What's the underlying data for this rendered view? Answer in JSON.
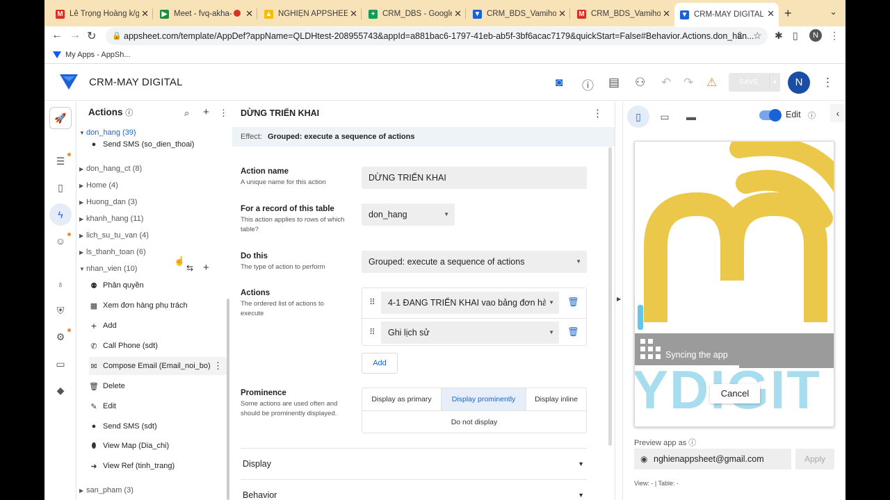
{
  "browser": {
    "tabs": [
      {
        "title": "Lê Trọng Hoàng k/g t",
        "favicon": "gmail-icon",
        "color": "#d93025"
      },
      {
        "title": "Meet - fvq-akha-",
        "favicon": "meet-icon",
        "color": "#1e8e3e"
      },
      {
        "title": "NGHIỆN APPSHEET -",
        "favicon": "drive-icon",
        "color": "#fbbc04"
      },
      {
        "title": "CRM_DBS - Google S",
        "favicon": "sheets-icon",
        "color": "#0f9d58"
      },
      {
        "title": "CRM_BDS_Vamihom",
        "favicon": "appsheet-icon",
        "color": "#1a63d6"
      },
      {
        "title": "CRM_BDS_Vamihom",
        "favicon": "gmail-icon",
        "color": "#d93025"
      },
      {
        "title": "CRM-MAY DIGITAL -",
        "favicon": "appsheet-icon",
        "color": "#1a63d6"
      }
    ],
    "url": "appsheet.com/template/AppDef?appName=QLDHtest-208955743&appId=a881bac6-1797-41eb-ab5f-3bf6acac7179&quickStart=False#Behavior.Actions.don_han...",
    "profile_initial": "N",
    "bookmark": "My Apps - AppSh..."
  },
  "app": {
    "name": "CRM-MAY DIGITAL",
    "save_label": "SAVE",
    "avatar_initial": "N"
  },
  "actions_panel": {
    "title": "Actions",
    "groups": [
      {
        "label": "don_hang (39)",
        "open": true
      },
      {
        "label": "don_hang_ct (8)"
      },
      {
        "label": "Home (4)"
      },
      {
        "label": "Huong_dan (3)"
      },
      {
        "label": "khanh_hang (11)"
      },
      {
        "label": "lich_su_tu_van (4)"
      },
      {
        "label": "ls_thanh_toan (6)"
      },
      {
        "label": "nhan_vien (10)",
        "open": true
      },
      {
        "label": "san_pham (3)"
      }
    ],
    "don_hang_items": [
      {
        "label": "Send SMS (so_dien_thoai)",
        "icon": "chat-icon"
      }
    ],
    "nhan_vien_items": [
      {
        "label": "Phân quyền",
        "icon": "people-icon"
      },
      {
        "label": "Xem đơn hàng phụ trách",
        "icon": "table-icon"
      },
      {
        "label": "Add",
        "icon": "plus-icon"
      },
      {
        "label": "Call Phone (sdt)",
        "icon": "phone-icon"
      },
      {
        "label": "Compose Email (Email_noi_bo)",
        "icon": "email-icon"
      },
      {
        "label": "Delete",
        "icon": "trash-icon"
      },
      {
        "label": "Edit",
        "icon": "edit-icon"
      },
      {
        "label": "Send SMS (sdt)",
        "icon": "chat-icon"
      },
      {
        "label": "View Map (Dia_chi)",
        "icon": "pin-icon"
      },
      {
        "label": "View Ref (tinh_trang)",
        "icon": "arrow-circle-icon"
      }
    ]
  },
  "editor": {
    "title": "DỪNG TRIỂN KHAI",
    "effect_label": "Effect:",
    "effect_value": "Grouped: execute a sequence of actions",
    "action_name": {
      "label": "Action name",
      "desc": "A unique name for this action",
      "value": "DỪNG TRIỂN KHAI"
    },
    "table": {
      "label": "For a record of this table",
      "desc": "This action applies to rows of which table?",
      "value": "don_hang"
    },
    "do_this": {
      "label": "Do this",
      "desc": "The type of action to perform",
      "value": "Grouped: execute a sequence of actions"
    },
    "actions": {
      "label": "Actions",
      "desc": "The ordered list of actions to execute",
      "items": [
        "4-1 ĐANG TRIỂN KHAI vao bảng đơn hà",
        "Ghi lịch sử"
      ],
      "add_label": "Add"
    },
    "prominence": {
      "label": "Prominence",
      "desc": "Some actions are used often and should be prominently displayed.",
      "options": [
        "Display as primary",
        "Display prominently",
        "Display inline"
      ],
      "selected": "Display prominently",
      "none_option": "Do not display"
    },
    "sections": [
      "Display",
      "Behavior"
    ]
  },
  "preview": {
    "edit_label": "Edit",
    "sync_text": "Syncing the app",
    "cancel_label": "Cancel",
    "preview_as_label": "Preview app as",
    "email": "nghienappsheet@gmail.com",
    "apply_label": "Apply",
    "view_info": "View:  -    |   Table:  -",
    "brand_text": "YDIGIT"
  },
  "colors": {
    "accent": "#1a63d6",
    "tabstrip": "#f8e2b7",
    "logo_yellow": "#ecc84a",
    "logo_blue": "#66c6e8"
  }
}
